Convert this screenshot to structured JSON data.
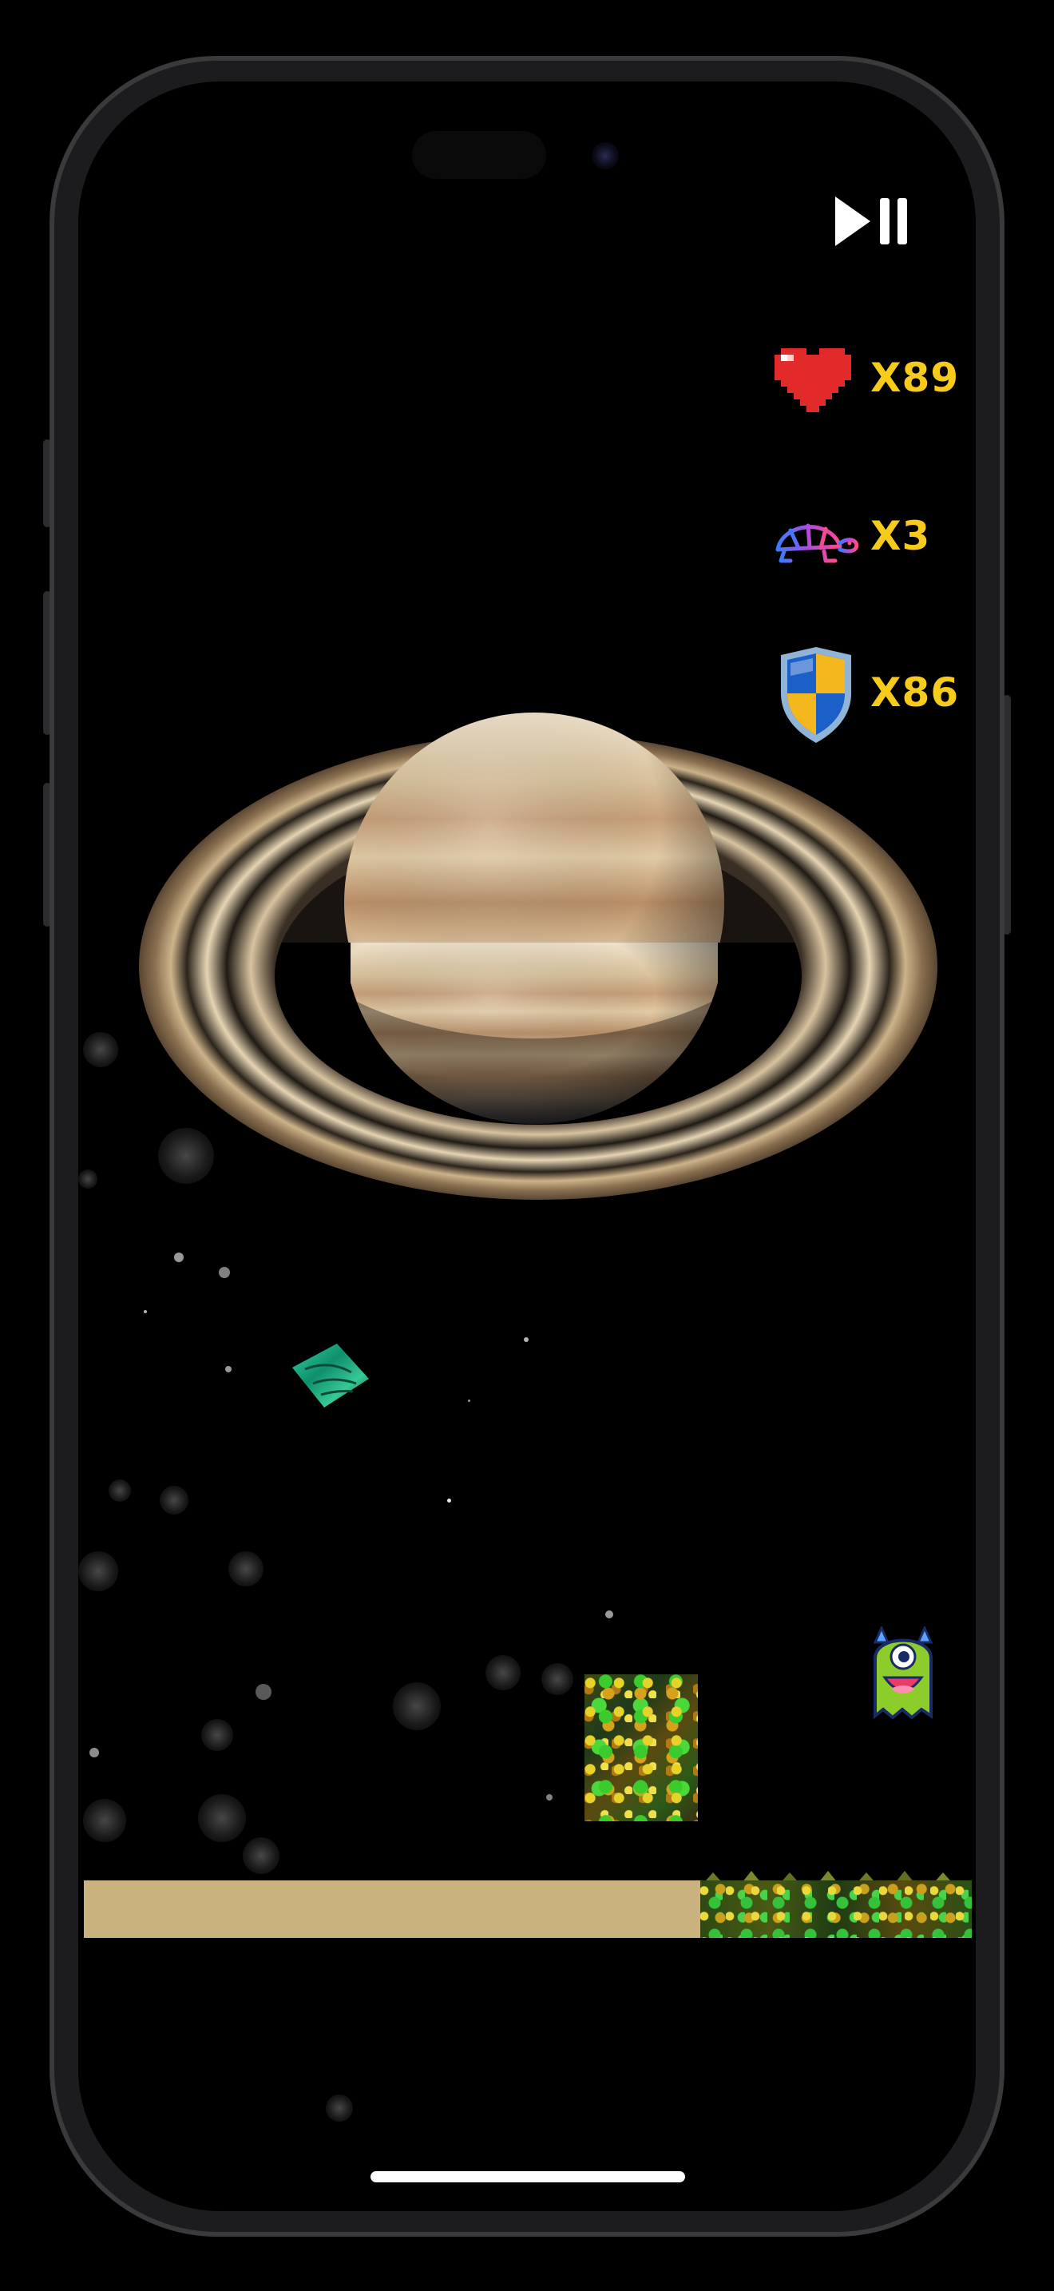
{
  "hud": {
    "pause_play_icon": "play-pause-icon",
    "stats": [
      {
        "icon": "heart-icon",
        "value": "X89",
        "color": "#f7cb1a"
      },
      {
        "icon": "turtle-icon",
        "value": "X3",
        "color": "#f7cb1a"
      },
      {
        "icon": "shield-icon",
        "value": "X86",
        "color": "#f7cb1a"
      }
    ]
  },
  "scene": {
    "background": "#000000",
    "planet": "saturn",
    "items": [
      "green-gem",
      "mossy-block",
      "one-eyed-monster"
    ],
    "ground": {
      "sand_color": "#cab27f",
      "moss": "mossy-ground-with-spikes"
    }
  }
}
